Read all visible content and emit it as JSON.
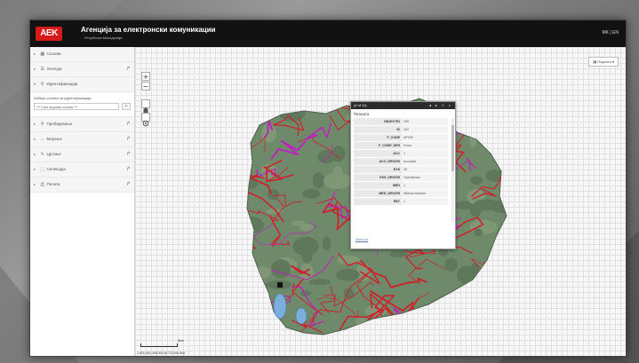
{
  "header": {
    "logo_text": "AEK",
    "title": "Агенција за електронски комуникации",
    "subtitle": "Република Македонија",
    "languages": "MK | EN"
  },
  "sidebar": {
    "items": [
      {
        "label": "Слоеви",
        "icon": "layers-icon",
        "share": false
      },
      {
        "label": "Легенда",
        "icon": "list-icon",
        "share": true
      },
      {
        "label": "Идентификација",
        "icon": "info-pin-icon",
        "share": false
      }
    ],
    "identify": {
      "prompt": "Избери слоеви за идентификација",
      "select_value": "*** Сите видливи слоеви ***",
      "button_label": "+"
    },
    "tools": [
      {
        "label": "Пребарување",
        "icon": "search-icon",
        "share": true
      },
      {
        "label": "Мерење",
        "icon": "ruler-icon",
        "share": true
      },
      {
        "label": "Цртање",
        "icon": "pencil-icon",
        "share": true
      },
      {
        "label": "Селекција",
        "icon": "select-icon",
        "share": true
      },
      {
        "label": "Печати",
        "icon": "print-icon",
        "share": true
      }
    ],
    "collapse_symbol": "‹"
  },
  "map": {
    "zoom_in": "+",
    "zoom_out": "−",
    "layers_button": "Подлоги",
    "scale_label": "5km",
    "coordinates": "1:500,000  498765.58  722286.868",
    "colors": {
      "roads": "#d0202c",
      "network": "#c020c0",
      "terrain": "#6e8a6a",
      "lake": "#7aaedc"
    }
  },
  "popup": {
    "counter": "(2 of 11)",
    "controls": [
      "◂",
      "▸",
      "□",
      "×"
    ],
    "layer_name": "Патишта",
    "attributes": [
      {
        "key": "OBJECTID",
        "value": "295"
      },
      {
        "key": "ID",
        "value": "422"
      },
      {
        "key": "F_CODE",
        "value": "AP030"
      },
      {
        "key": "F_CODE_DES",
        "value": "Road"
      },
      {
        "key": "ACC",
        "value": "1"
      },
      {
        "key": "ACC_DESCRI",
        "value": "Accurate"
      },
      {
        "key": "EXS",
        "value": "28"
      },
      {
        "key": "EXS_DESCRI",
        "value": "Operational"
      },
      {
        "key": "MED",
        "value": "1"
      },
      {
        "key": "MED_DESCRI",
        "value": "Without Median"
      },
      {
        "key": "RST",
        "value": "1"
      }
    ],
    "zoom_link": "Zoom to"
  }
}
